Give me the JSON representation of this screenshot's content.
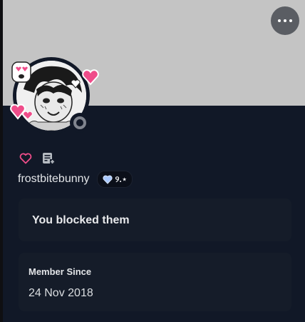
{
  "profile": {
    "username": "frostbitebunny",
    "badge": {
      "icon": "blue-heart-icon",
      "text": "୨.⋆"
    },
    "status": "offline",
    "actions": {
      "more_icon": "more-horizontal-icon",
      "like_icon": "heart-outline-icon",
      "note_icon": "add-note-icon"
    }
  },
  "blocked_notice": {
    "text": "You blocked them"
  },
  "member_since": {
    "label": "Member Since",
    "value": "24 Nov 2018"
  },
  "colors": {
    "banner": "#c4c4c4",
    "card_bg": "#111827",
    "section_bg": "#151c29",
    "heart_pink": "#ef4d8a",
    "status_offline": "#80848e"
  }
}
